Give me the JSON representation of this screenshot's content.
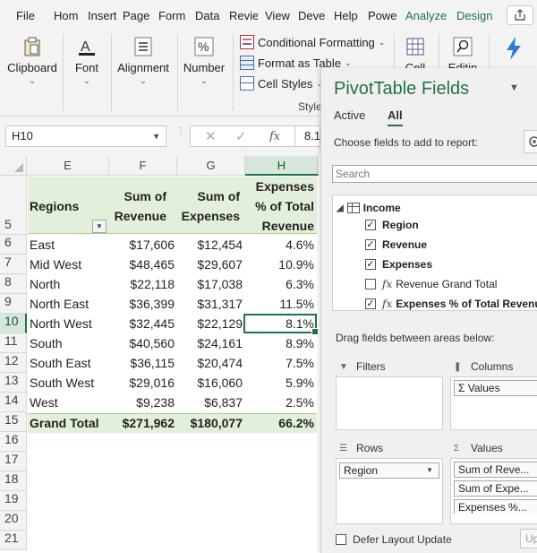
{
  "ribbon": {
    "tabs": [
      "File",
      "Hom",
      "Insert",
      "Page",
      "Form",
      "Data",
      "Revie",
      "View",
      "Deve",
      "Help",
      "Powe",
      "Analyze",
      "Design"
    ],
    "groups": {
      "clipboard": "Clipboard",
      "font": "Font",
      "alignment": "Alignment",
      "number": "Number",
      "cells_partial": "Cell",
      "editing_partial": "Editin",
      "styles_partial": "Style"
    },
    "styles": {
      "conditional": "Conditional Formatting",
      "format_table": "Format as Table",
      "cell_styles": "Cell Styles"
    },
    "accent_color": "#217346"
  },
  "formula_bar": {
    "name_box": "H10",
    "value": "8.1"
  },
  "sheet": {
    "columns": [
      "E",
      "F",
      "G",
      "H"
    ],
    "header_row": "5",
    "headers": {
      "regions": "Regions",
      "revenue": [
        "Sum of",
        "Revenue"
      ],
      "expenses": [
        "Sum of",
        "Expenses"
      ],
      "pct": [
        "Expenses",
        "% of Total",
        "Revenue"
      ]
    },
    "rows": [
      {
        "num": "6",
        "region": "East",
        "revenue": "$17,606",
        "expenses": "$12,454",
        "pct": "4.6%"
      },
      {
        "num": "7",
        "region": "Mid West",
        "revenue": "$48,465",
        "expenses": "$29,607",
        "pct": "10.9%"
      },
      {
        "num": "8",
        "region": "North",
        "revenue": "$22,118",
        "expenses": "$17,038",
        "pct": "6.3%"
      },
      {
        "num": "9",
        "region": "North East",
        "revenue": "$36,399",
        "expenses": "$31,317",
        "pct": "11.5%"
      },
      {
        "num": "10",
        "region": "North West",
        "revenue": "$32,445",
        "expenses": "$22,129",
        "pct": "8.1%"
      },
      {
        "num": "11",
        "region": "South",
        "revenue": "$40,560",
        "expenses": "$24,161",
        "pct": "8.9%"
      },
      {
        "num": "12",
        "region": "South East",
        "revenue": "$36,115",
        "expenses": "$20,474",
        "pct": "7.5%"
      },
      {
        "num": "13",
        "region": "South West",
        "revenue": "$29,016",
        "expenses": "$16,060",
        "pct": "5.9%"
      },
      {
        "num": "14",
        "region": "West",
        "revenue": "$9,238",
        "expenses": "$6,837",
        "pct": "2.5%"
      }
    ],
    "grand_total": {
      "num": "15",
      "label": "Grand Total",
      "revenue": "$271,962",
      "expenses": "$180,077",
      "pct": "66.2%"
    },
    "empty_rows": [
      "16",
      "17",
      "18",
      "19",
      "20",
      "21"
    ]
  },
  "pivot": {
    "title": "PivotTable Fields",
    "tabs": {
      "active": "Active",
      "all": "All"
    },
    "choose_text": "Choose fields to add to report:",
    "search_placeholder": "Search",
    "table_name": "Income",
    "fields": [
      {
        "label": "Region",
        "checked": true,
        "fx": false,
        "bold": true
      },
      {
        "label": "Revenue",
        "checked": true,
        "fx": false,
        "bold": true
      },
      {
        "label": "Expenses",
        "checked": true,
        "fx": false,
        "bold": true
      },
      {
        "label": "Revenue Grand Total",
        "checked": false,
        "fx": true,
        "bold": false
      },
      {
        "label": "Expenses % of Total Revenue",
        "checked": true,
        "fx": true,
        "bold": true
      }
    ],
    "drag_text": "Drag fields between areas below:",
    "areas": {
      "filters": "Filters",
      "columns": "Columns",
      "rows": "Rows",
      "values": "Values"
    },
    "column_items": [
      "Values"
    ],
    "row_items": [
      "Region"
    ],
    "value_items": [
      "Sum of Reve...",
      "Sum of Expe...",
      "Expenses %..."
    ],
    "defer_label": "Defer Layout Update",
    "update_label": "Up"
  }
}
